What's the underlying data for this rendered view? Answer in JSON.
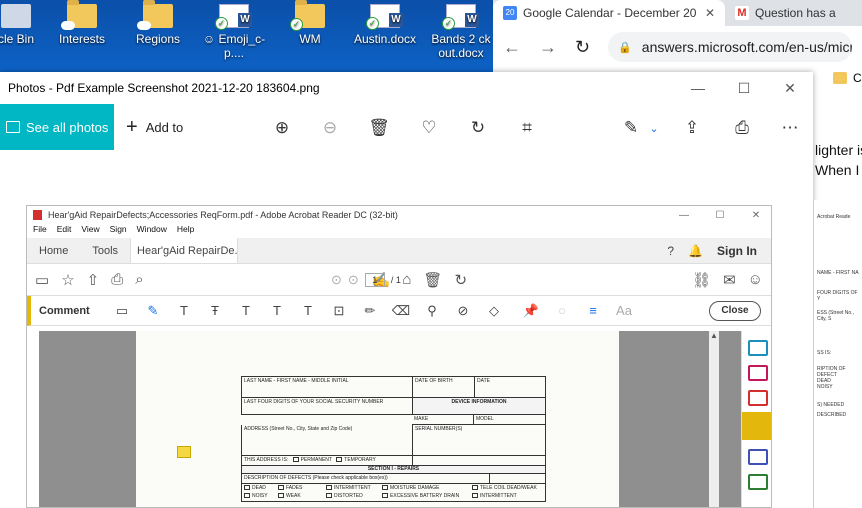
{
  "desktop": {
    "icons": [
      {
        "label": "cle Bin",
        "type": "recycle"
      },
      {
        "label": "Interests",
        "type": "folder"
      },
      {
        "label": "Regions",
        "type": "folder"
      },
      {
        "label": "☺ Emoji_c-p....",
        "type": "docx"
      },
      {
        "label": "WM",
        "type": "folder"
      },
      {
        "label": "Austin.docx",
        "type": "docx"
      },
      {
        "label": "Bands 2 ck out.docx",
        "type": "docx"
      }
    ]
  },
  "chrome": {
    "tabs": [
      {
        "title": "Google Calendar - December 20",
        "icon": "calendar-icon",
        "fav_text": "20"
      },
      {
        "title": "Question has a",
        "icon": "gmail-icon",
        "fav_text": "M"
      }
    ],
    "url": "answers.microsoft.com/en-us/micros",
    "page_snippets": [
      "lighter is",
      "When I"
    ],
    "bookmark_fragment": "C"
  },
  "photos": {
    "title": "Photos - Pdf Example Screenshot 2021-12-20 183604.png",
    "see_all_label": "See all photos",
    "add_to_label": "Add to",
    "controls": {
      "minimize": "—",
      "maximize": "☐",
      "close": "✕"
    }
  },
  "acrobat": {
    "title": "Hear'gAid RepairDefects;Accessories ReqForm.pdf - Adobe Acrobat Reader DC (32-bit)",
    "menu": [
      "File",
      "Edit",
      "View",
      "Sign",
      "Window",
      "Help"
    ],
    "tabs": {
      "home": "Home",
      "tools": "Tools",
      "doc": "Hear'gAid RepairDe...",
      "doc_close": "×"
    },
    "sign_in": "Sign In",
    "page_current": "1",
    "page_total": "/ 1",
    "comment_label": "Comment",
    "close_label": "Close",
    "accent": "#e3b70b",
    "form": {
      "r1": [
        "LAST NAME - FIRST NAME - MIDDLE INITIAL",
        "DATE OF BIRTH",
        "DATE"
      ],
      "r2": [
        "LAST FOUR DIGITS OF YOUR SOCIAL SECURITY NUMBER",
        "DEVICE INFORMATION"
      ],
      "r2b": [
        "MAKE",
        "MODEL"
      ],
      "r3": [
        "ADDRESS (Street No., City, State and Zip Code)",
        "SERIAL NUMBER(S)"
      ],
      "r4": [
        "THIS ADDRESS IS:",
        "PERMANENT",
        "TEMPORARY"
      ],
      "section": "SECTION I - REPAIRS",
      "defects_hdr": "DESCRIPTION OF DEFECTS (Please check applicable box(es))",
      "defects": [
        "DEAD",
        "FADES",
        "INTERMITTENT",
        "MOISTURE DAMAGE",
        "TELE COIL DEAD/WEAK",
        "NOISY",
        "WEAK",
        "DISTORTED",
        "EXCESSIVE BATTERY DRAIN",
        "INTERMITTENT"
      ]
    }
  },
  "sliver": {
    "lines": [
      "Acrobat Reade",
      "NAME - FIRST NA",
      "FOUR DIGITS OF Y",
      "ESS (Street No., City, S",
      "SS IS:",
      "RIPTION OF DEFECT",
      "DEAD",
      "NOISY",
      "S) NEEDED",
      "DESCRIBED"
    ]
  }
}
